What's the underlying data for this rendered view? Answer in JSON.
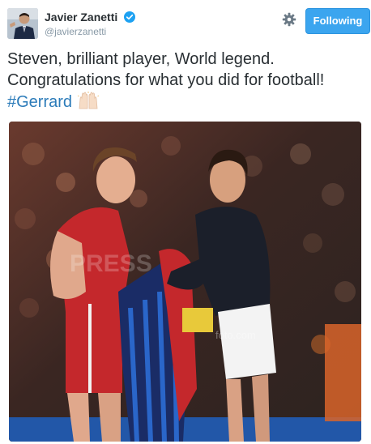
{
  "user": {
    "display_name": "Javier Zanetti",
    "screen_name": "@javierzanetti",
    "verified": true,
    "avatar_icon": "profile-avatar"
  },
  "actions": {
    "settings_icon": "gear-icon",
    "follow_label": "Following"
  },
  "tweet": {
    "line1": "Steven, brilliant player, World legend.",
    "line2": "Congratulations for what you did for football!",
    "hashtag": "#Gerrard",
    "emoji": "raised-hands-icon"
  },
  "media": {
    "watermark": "PRESS",
    "watermark_site": "foto.com"
  },
  "colors": {
    "follow_button": "#3ba5ef",
    "hashtag": "#2b7bb9",
    "verified_badge": "#1da1f2"
  }
}
